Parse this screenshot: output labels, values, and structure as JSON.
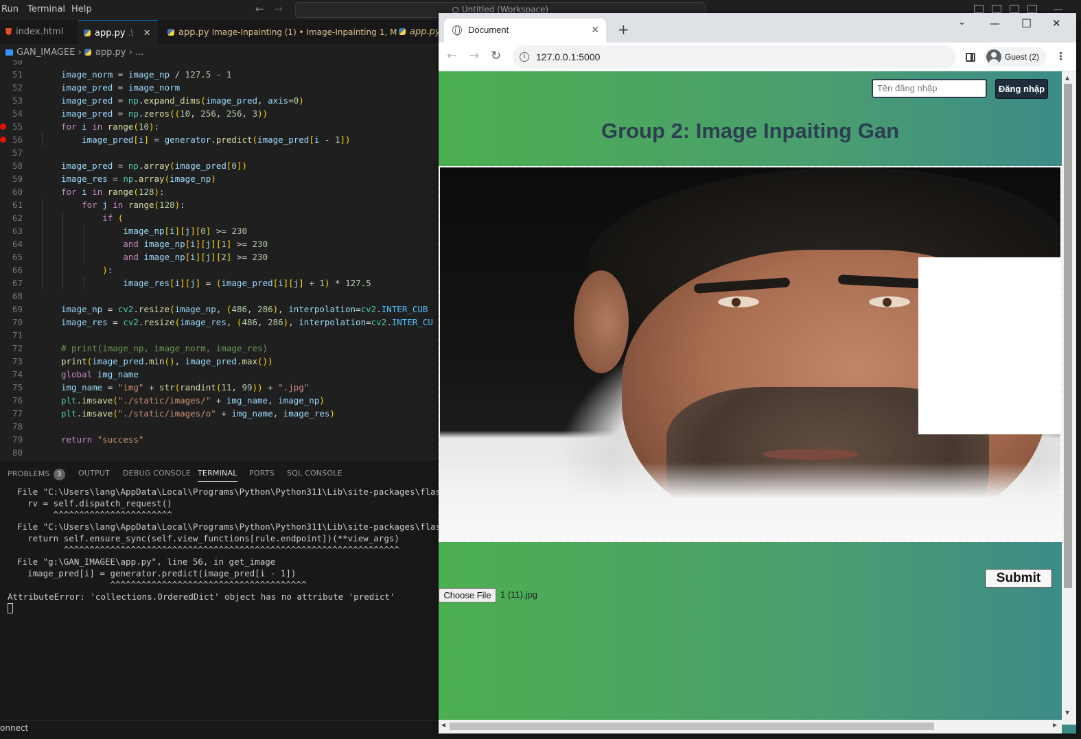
{
  "vscode": {
    "menu": [
      "Run",
      "Terminal",
      "Help"
    ],
    "search_text": "Untitled (Workspace)",
    "tabs": [
      {
        "label": "index.html",
        "detail": "",
        "badge": "",
        "close": ""
      },
      {
        "label": "app.py",
        "detail": ".\\",
        "badge": "",
        "close": "✕"
      },
      {
        "label": "app.py",
        "detail": "Image-Inpainting (1) • Image-Inpainting",
        "badge": "1, M",
        "close": ""
      },
      {
        "label": "app.py",
        "detail": "",
        "badge": "",
        "close": ""
      }
    ],
    "breadcrumb": {
      "folder": "GAN_IMAGEE",
      "file": "app.py",
      "more": "..."
    },
    "code_lines": [
      {
        "n": "50",
        "t": ""
      },
      {
        "n": "51",
        "t": "image_norm = image_np / 127.5 - 1"
      },
      {
        "n": "52",
        "t": "image_pred = image_norm"
      },
      {
        "n": "53",
        "t": "image_pred = np.expand_dims(image_pred, axis=0)"
      },
      {
        "n": "54",
        "t": "image_pred = np.zeros((10, 256, 256, 3))"
      },
      {
        "n": "55",
        "t": "for i in range(10):"
      },
      {
        "n": "56",
        "t": "    image_pred[i] = generator.predict(image_pred[i - 1])"
      },
      {
        "n": "57",
        "t": ""
      },
      {
        "n": "58",
        "t": "image_pred = np.array(image_pred[0])"
      },
      {
        "n": "59",
        "t": "image_res = np.array(image_np)"
      },
      {
        "n": "60",
        "t": "for i in range(128):"
      },
      {
        "n": "61",
        "t": "    for j in range(128):"
      },
      {
        "n": "62",
        "t": "        if ("
      },
      {
        "n": "63",
        "t": "            image_np[i][j][0] >= 230"
      },
      {
        "n": "64",
        "t": "            and image_np[i][j][1] >= 230"
      },
      {
        "n": "65",
        "t": "            and image_np[i][j][2] >= 230"
      },
      {
        "n": "66",
        "t": "        ):"
      },
      {
        "n": "67",
        "t": "            image_res[i][j] = (image_pred[i][j] + 1) * 127.5"
      },
      {
        "n": "68",
        "t": ""
      },
      {
        "n": "69",
        "t": "image_np = cv2.resize(image_np, (486, 286), interpolation=cv2.INTER_CUB"
      },
      {
        "n": "70",
        "t": "image_res = cv2.resize(image_res, (486, 286), interpolation=cv2.INTER_CU"
      },
      {
        "n": "71",
        "t": ""
      },
      {
        "n": "72",
        "t": "# print(image_np, image_norm, image_res)"
      },
      {
        "n": "73",
        "t": "print(image_pred.min(), image_pred.max())"
      },
      {
        "n": "74",
        "t": "global img_name"
      },
      {
        "n": "75",
        "t": "img_name = \"img\" + str(randint(11, 99)) + \".jpg\""
      },
      {
        "n": "76",
        "t": "plt.imsave(\"./static/images/\" + img_name, image_np)"
      },
      {
        "n": "77",
        "t": "plt.imsave(\"./static/images/o\" + img_name, image_res)"
      },
      {
        "n": "78",
        "t": ""
      },
      {
        "n": "79",
        "t": "return \"success\""
      },
      {
        "n": "80",
        "t": ""
      }
    ],
    "panel_tabs": [
      "PROBLEMS",
      "OUTPUT",
      "DEBUG CONSOLE",
      "TERMINAL",
      "PORTS",
      "SQL CONSOLE"
    ],
    "problems_count": "3",
    "terminal_lines": [
      "File \"C:\\Users\\lang\\AppData\\Local\\Programs\\Python\\Python311\\Lib\\site-packages\\flask\\app.py",
      "  rv = self.dispatch_request()",
      "       ^^^^^^^^^^^^^^^^^^^^^^^",
      "File \"C:\\Users\\lang\\AppData\\Local\\Programs\\Python\\Python311\\Lib\\site-packages\\flask\\app.py",
      "  return self.ensure_sync(self.view_functions[rule.endpoint])(**view_args)",
      "         ^^^^^^^^^^^^^^^^^^^^^^^^^^^^^^^^^^^^^^^^^^^^^^^^^^^^^^^^^^^^^^^^^",
      "File \"g:\\GAN_IMAGEE\\app.py\", line 56, in get_image",
      "  image_pred[i] = generator.predict(image_pred[i - 1])",
      "                  ^^^^^^^^^^^^^^^^^^^^^^^^^^^^^^^^^^^^^^",
      "AttributeError: 'collections.OrderedDict' object has no attribute 'predict'"
    ],
    "status_text": "onnect"
  },
  "browser": {
    "tab_title": "Document",
    "url": "127.0.0.1:5000",
    "profile_label": "Guest (2)",
    "page": {
      "username_placeholder": "Tên đăng nhập",
      "login_button": "Đăng nhập",
      "heading": "Group 2: Image Inpaiting Gan",
      "submit_button": "Submit",
      "choose_file_button": "Choose File",
      "file_name": "1 (11).jpg"
    }
  },
  "colors": {
    "vscode_bg": "#1f1f1f",
    "page_green": "#4caf50",
    "page_teal": "#3b8a8a",
    "heading": "#2c3e50",
    "breakpoint": "#e51400"
  }
}
